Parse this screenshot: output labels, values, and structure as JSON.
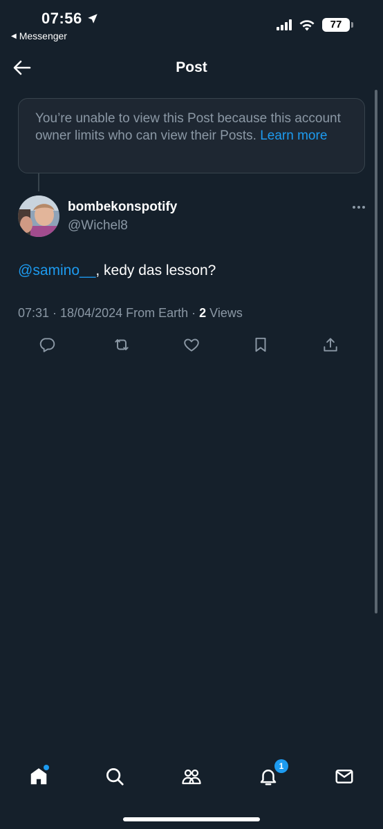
{
  "status_bar": {
    "time": "07:56",
    "back_app": "Messenger",
    "battery": "77"
  },
  "header": {
    "title": "Post"
  },
  "notice": {
    "text": "You’re unable to view this Post because this account owner limits who can view their Posts.",
    "link": "Learn more"
  },
  "post": {
    "author_name": "bombekonspotify",
    "author_handle": "@Wichel8",
    "mention": "@samino__",
    "text_rest": ", kedy das lesson?",
    "meta_prefix": "07:31 · 18/04/2024 From Earth · ",
    "views_count": "2",
    "views_label": " Views"
  },
  "bottom_nav": {
    "notifications_badge": "1"
  },
  "colors": {
    "background": "#15202b",
    "accent": "#1d9bf0",
    "secondary_text": "#8b98a5",
    "border": "#38444d"
  },
  "icons": [
    "location-arrow-icon",
    "signal-icon",
    "wifi-icon",
    "battery-icon",
    "back-arrow-icon",
    "more-icon",
    "reply-icon",
    "repost-icon",
    "like-icon",
    "bookmark-icon",
    "share-icon",
    "home-icon",
    "search-icon",
    "communities-icon",
    "notifications-icon",
    "messages-icon"
  ]
}
